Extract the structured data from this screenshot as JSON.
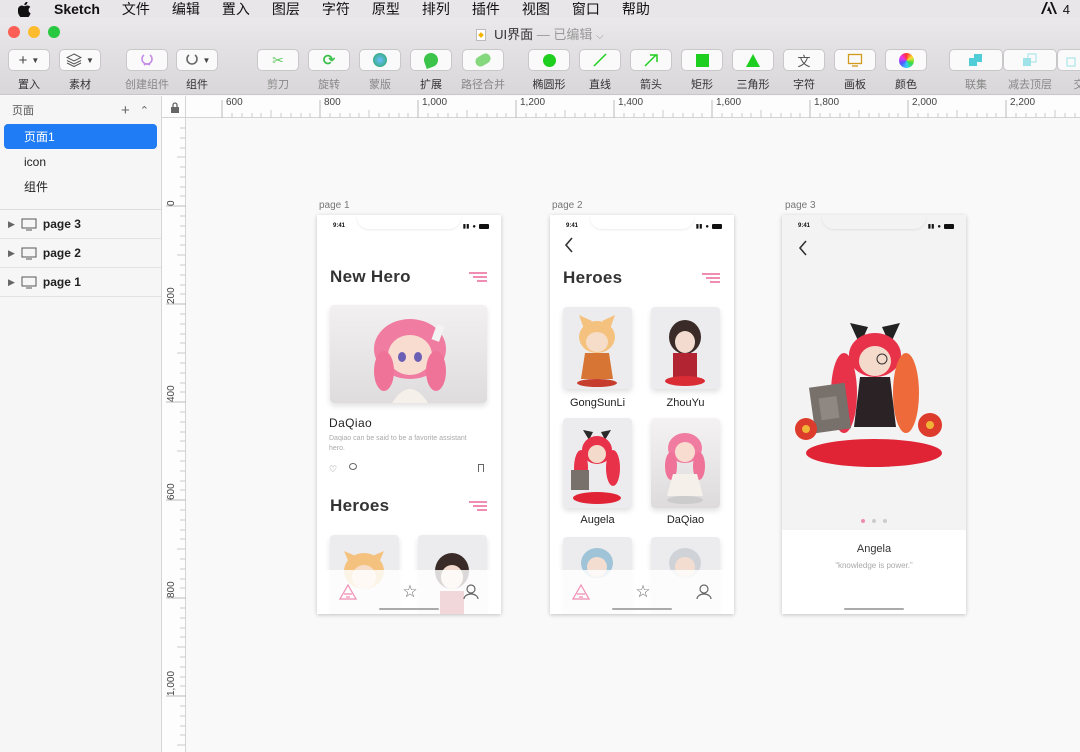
{
  "menubar": {
    "app_name": "Sketch",
    "items": [
      "文件",
      "编辑",
      "置入",
      "图层",
      "字符",
      "原型",
      "排列",
      "插件",
      "视图",
      "窗口",
      "帮助"
    ],
    "right_text": "4"
  },
  "window": {
    "title": "UI界面",
    "subtitle": "— 已编辑"
  },
  "toolbar": {
    "insert": "置入",
    "assets": "素材",
    "create_symbol": "创建组件",
    "symbols": "组件",
    "scissors": "剪刀",
    "rotate": "旋转",
    "mask": "蒙版",
    "expand": "扩展",
    "path_union": "路径合并",
    "oval": "椭圆形",
    "line": "直线",
    "arrow": "箭头",
    "rect": "矩形",
    "triangle": "三角形",
    "text": "字符",
    "artboard": "画板",
    "color": "颜色",
    "union": "联集",
    "subtract": "减去顶层",
    "more": "交"
  },
  "colors": {
    "accent": "#1f7cf4",
    "pink": "#f08db2",
    "shape_green": "#1fcf1f"
  },
  "sidebar": {
    "header": "页面",
    "pages": [
      "页面1",
      "icon",
      "组件"
    ],
    "artboards": [
      "page 3",
      "page 2",
      "page 1"
    ]
  },
  "rulers": {
    "h": [
      "600",
      "800",
      "1,000",
      "1,200",
      "1,400",
      "1,600",
      "1,800",
      "2,000",
      "2,200"
    ],
    "v": [
      "0",
      "200",
      "400",
      "600",
      "800",
      "1,000"
    ]
  },
  "artboards": {
    "page1": {
      "label": "page 1",
      "time": "9:41",
      "title_new_hero": "New Hero",
      "hero_name": "DaQiao",
      "hero_desc": "Daqiao can be said to be a favorite assistant hero.",
      "title_heroes": "Heroes"
    },
    "page2": {
      "label": "page 2",
      "time": "9:41",
      "title": "Heroes",
      "heroes": [
        "GongSunLi",
        "ZhouYu",
        "Augela",
        "DaQiao"
      ]
    },
    "page3": {
      "label": "page 3",
      "time": "9:41",
      "name": "Angela",
      "quote": "“knowledge is power.”"
    }
  }
}
